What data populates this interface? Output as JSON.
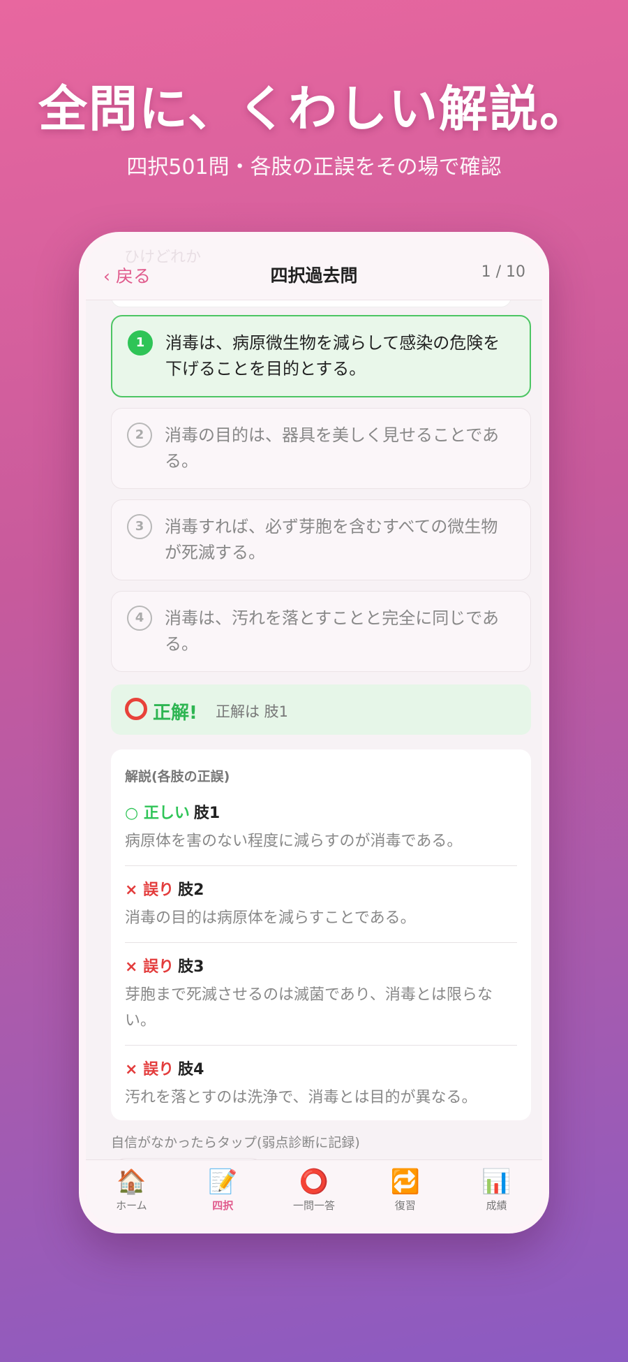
{
  "hero": {
    "headline": "全問に、くわしい解説。",
    "subline": "四択501問・各肢の正誤をその場で確認"
  },
  "nav": {
    "back_label": "‹ 戻る",
    "title": "四択過去問",
    "progress": "1 / 10",
    "ghost": "ひけどれか"
  },
  "options": [
    {
      "num": "1",
      "text": "消毒は、病原微生物を減らして感染の危険を下げることを目的とする。",
      "state": "correct"
    },
    {
      "num": "2",
      "text": "消毒の目的は、器具を美しく見せることである。",
      "state": "normal"
    },
    {
      "num": "3",
      "text": "消毒すれば、必ず芽胞を含むすべての微生物が死滅する。",
      "state": "normal"
    },
    {
      "num": "4",
      "text": "消毒は、汚れを落とすことと完全に同じである。",
      "state": "normal"
    }
  ],
  "result": {
    "title": "正解!",
    "detail": "正解は 肢1"
  },
  "explanation": {
    "heading": "解説(各肢の正誤)",
    "items": [
      {
        "verdict": "○ 正しい",
        "choice": "肢1",
        "type": "ok",
        "text": "病原体を害のない程度に減らすのが消毒である。"
      },
      {
        "verdict": "× 誤り",
        "choice": "肢2",
        "type": "ng",
        "text": "消毒の目的は病原体を減らすことである。"
      },
      {
        "verdict": "× 誤り",
        "choice": "肢3",
        "type": "ng",
        "text": "芽胞まで死滅させるのは滅菌であり、消毒とは限らない。"
      },
      {
        "verdict": "× 誤り",
        "choice": "肢4",
        "type": "ng",
        "text": "汚れを落とすのは洗浄で、消毒とは目的が異なる。"
      }
    ]
  },
  "note": "自信がなかったらタップ(弱点診断に記録)",
  "tabs": [
    {
      "icon": "🏠",
      "icon_name": "home-icon",
      "label": "ホーム",
      "active": false
    },
    {
      "icon": "📝",
      "icon_name": "memo-icon",
      "label": "四択",
      "active": true
    },
    {
      "icon": "⭕",
      "icon_name": "circle-icon",
      "label": "一問一答",
      "active": false
    },
    {
      "icon": "🔁",
      "icon_name": "repeat-icon",
      "label": "復習",
      "active": false
    },
    {
      "icon": "📊",
      "icon_name": "chart-icon",
      "label": "成績",
      "active": false
    }
  ],
  "colors": {
    "accent": "#e05a8c",
    "correct": "#2fc457",
    "wrong": "#e33c3c"
  }
}
